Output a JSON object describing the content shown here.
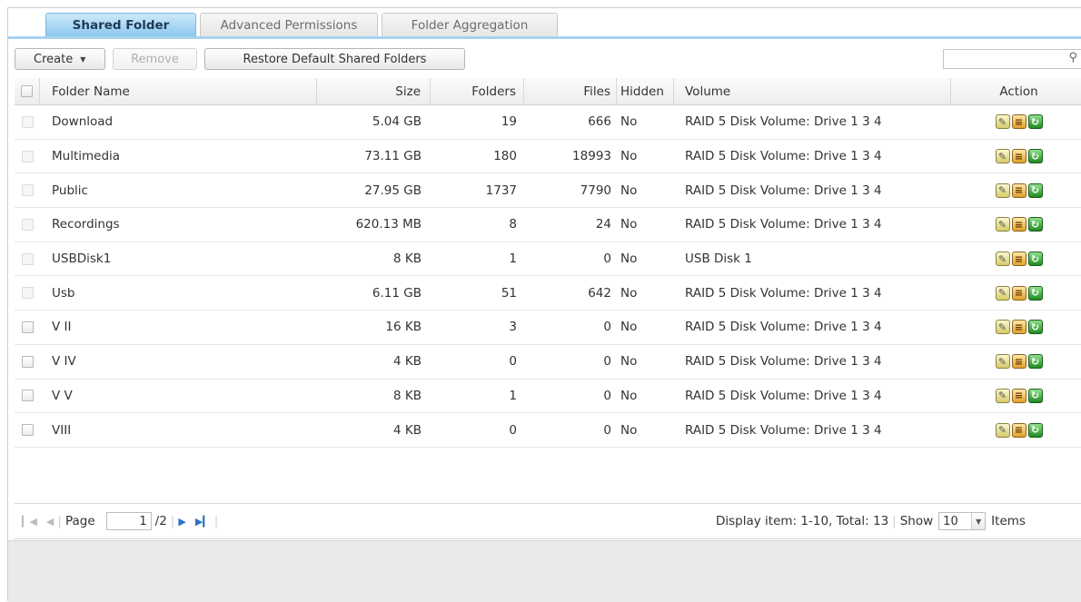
{
  "tabs": [
    {
      "label": "Shared Folder",
      "active": true
    },
    {
      "label": "Advanced Permissions",
      "active": false
    },
    {
      "label": "Folder Aggregation",
      "active": false
    }
  ],
  "toolbar": {
    "create_label": "Create",
    "remove_label": "Remove",
    "restore_label": "Restore Default Shared Folders",
    "search_placeholder": ""
  },
  "columns": {
    "name": "Folder Name",
    "size": "Size",
    "folders": "Folders",
    "files": "Files",
    "hidden": "Hidden",
    "volume": "Volume",
    "action": "Action"
  },
  "rows": [
    {
      "name": "Download",
      "size": "5.04 GB",
      "folders": "19",
      "files": "666",
      "hidden": "No",
      "volume": "RAID 5 Disk Volume: Drive 1 3 4",
      "checkbox_enabled": false
    },
    {
      "name": "Multimedia",
      "size": "73.11 GB",
      "folders": "180",
      "files": "18993",
      "hidden": "No",
      "volume": "RAID 5 Disk Volume: Drive 1 3 4",
      "checkbox_enabled": false
    },
    {
      "name": "Public",
      "size": "27.95 GB",
      "folders": "1737",
      "files": "7790",
      "hidden": "No",
      "volume": "RAID 5 Disk Volume: Drive 1 3 4",
      "checkbox_enabled": false
    },
    {
      "name": "Recordings",
      "size": "620.13 MB",
      "folders": "8",
      "files": "24",
      "hidden": "No",
      "volume": "RAID 5 Disk Volume: Drive 1 3 4",
      "checkbox_enabled": false
    },
    {
      "name": "USBDisk1",
      "size": "8 KB",
      "folders": "1",
      "files": "0",
      "hidden": "No",
      "volume": "USB Disk 1",
      "checkbox_enabled": false
    },
    {
      "name": "Usb",
      "size": "6.11 GB",
      "folders": "51",
      "files": "642",
      "hidden": "No",
      "volume": "RAID 5 Disk Volume: Drive 1 3 4",
      "checkbox_enabled": false
    },
    {
      "name": "V II",
      "size": "16 KB",
      "folders": "3",
      "files": "0",
      "hidden": "No",
      "volume": "RAID 5 Disk Volume: Drive 1 3 4",
      "checkbox_enabled": true
    },
    {
      "name": "V IV",
      "size": "4 KB",
      "folders": "0",
      "files": "0",
      "hidden": "No",
      "volume": "RAID 5 Disk Volume: Drive 1 3 4",
      "checkbox_enabled": true
    },
    {
      "name": "V V",
      "size": "8 KB",
      "folders": "1",
      "files": "0",
      "hidden": "No",
      "volume": "RAID 5 Disk Volume: Drive 1 3 4",
      "checkbox_enabled": true
    },
    {
      "name": "VIII",
      "size": "4 KB",
      "folders": "0",
      "files": "0",
      "hidden": "No",
      "volume": "RAID 5 Disk Volume: Drive 1 3 4",
      "checkbox_enabled": true
    }
  ],
  "action_icons": [
    "edit-icon",
    "permission-icon",
    "refresh-icon"
  ],
  "pager": {
    "page_label": "Page",
    "current_page": "1",
    "total_pages": "/2",
    "display_text": "Display item: 1-10, Total: 13",
    "show_label": "Show",
    "show_value": "10",
    "items_label": "Items"
  },
  "colors": {
    "active_tab": "#8cc8ee",
    "accent": "#2a72c9",
    "edit_icon": "#d6cb6a",
    "permission_icon": "#e0a12a",
    "refresh_icon": "#1f8a1f"
  }
}
